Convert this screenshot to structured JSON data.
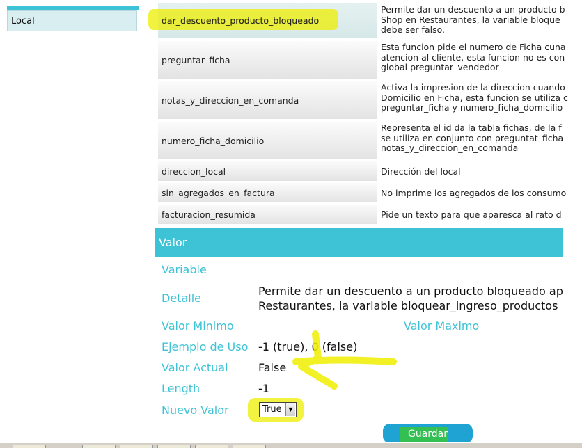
{
  "sidebar": {
    "items": [
      {
        "label": "Local"
      }
    ]
  },
  "table": {
    "rows": [
      {
        "name": "dar_descuento_producto_bloqueado",
        "desc": "Permite dar un descuento a un producto b\nShop en Restaurantes, la variable bloque\ndebe ser falso."
      },
      {
        "name": "preguntar_ficha",
        "desc": "Esta funcion pide el numero de Ficha cuna\natencion al cliente, esta funcion no es con\nglobal preguntar_vendedor"
      },
      {
        "name": "notas_y_direccion_en_comanda",
        "desc": "Activa la impresion de la direccion cuando\nDomicilio en Ficha, esta funcion se utiliza c\npreguntar_ficha y numero_ficha_domicilio"
      },
      {
        "name": "numero_ficha_domicilio",
        "desc": "Representa el id da la tabla fichas, de la f\nse utiliza en conjunto con preguntat_ficha\nnotas_y_direccion_en_comanda"
      },
      {
        "name": "direccion_local",
        "desc": "Dirección del local"
      },
      {
        "name": "sin_agregados_en_factura",
        "desc": "No imprime los agregados de los consumo"
      },
      {
        "name": "facturacion_resumida",
        "desc": "Pide un texto para que aparesca al rato d"
      }
    ]
  },
  "valor": {
    "header": "Valor",
    "variable_label": "Variable",
    "detalle_label": "Detalle",
    "detalle_value": "Permite dar un descuento a un producto bloqueado ap\nRestaurantes, la variable bloquear_ingreso_productos",
    "min_label": "Valor Minimo",
    "max_label": "Valor Maximo",
    "ejemplo_label": "Ejemplo de Uso",
    "ejemplo_value": "-1 (true), 0 (false)",
    "actual_label": "Valor Actual",
    "actual_value": "False",
    "length_label": "Length",
    "length_value": "-1",
    "nuevo_label": "Nuevo Valor",
    "nuevo_value": "True",
    "save_label": "Guardar"
  },
  "colors": {
    "accent": "#3ec3d6",
    "button": "#1fa3d3",
    "highlight_yellow": "#eeee00",
    "highlight_green": "#3cc828"
  }
}
